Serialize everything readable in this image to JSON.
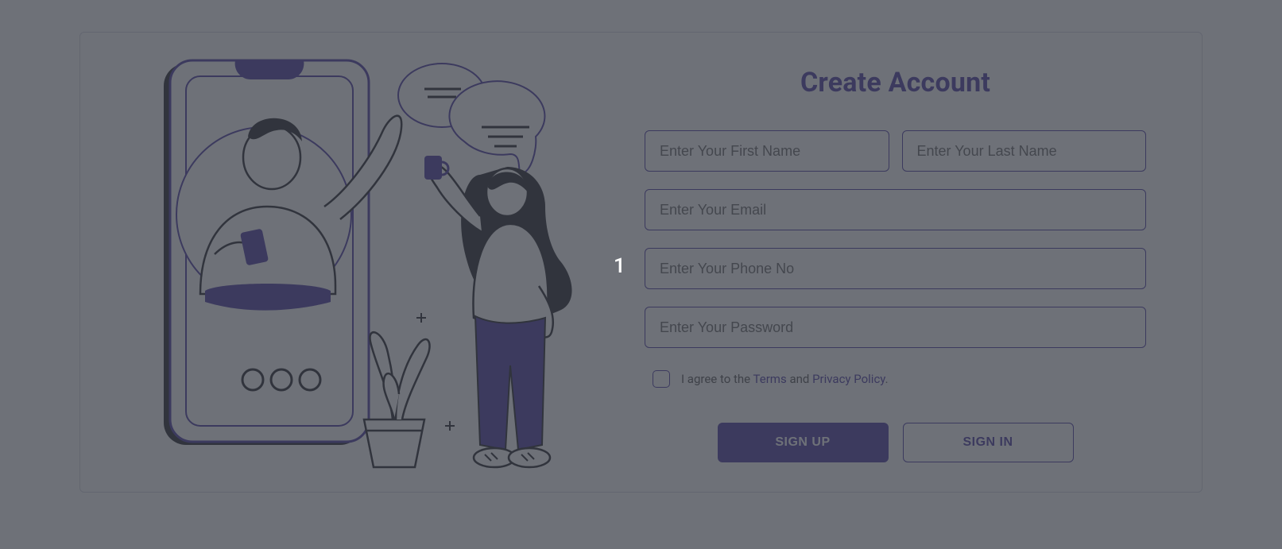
{
  "title": "Create Account",
  "placeholders": {
    "first_name": "Enter Your First Name",
    "last_name": "Enter Your Last Name",
    "email": "Enter Your Email",
    "phone": "Enter Your Phone No",
    "password": "Enter Your Password"
  },
  "agree": {
    "prefix": "I agree to the ",
    "terms": "Terms",
    "and": " and ",
    "privacy": "Privacy Policy",
    "suffix": "."
  },
  "buttons": {
    "signup": "SIGN UP",
    "signin": "SIGN IN"
  },
  "overlay_number": "1",
  "colors": {
    "accent": "#4b3ba3",
    "dark": "#26272b"
  }
}
